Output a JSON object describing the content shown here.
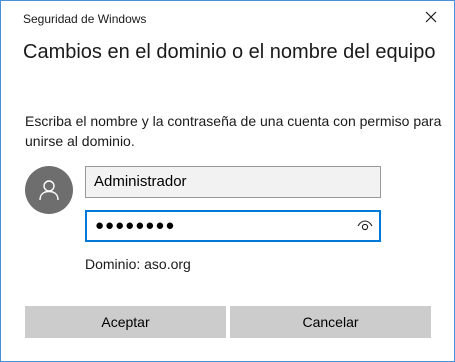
{
  "window": {
    "title": "Seguridad de Windows",
    "close_icon": "close-icon"
  },
  "heading": "Cambios en el dominio o el nombre del equipo",
  "description": "Escriba el nombre y la contraseña de una cuenta con permiso para unirse al dominio.",
  "avatar_icon": "user-avatar-icon",
  "username": {
    "value": "Administrador"
  },
  "password": {
    "masked_value": "●●●●●●●●",
    "reveal_icon": "eye-icon"
  },
  "domain_text": "Dominio: aso.org",
  "buttons": {
    "ok": "Aceptar",
    "cancel": "Cancelar"
  },
  "colors": {
    "accent": "#0078d7",
    "button_bg": "#cccccc",
    "avatar_bg": "#6e6e6e",
    "dialog_border": "#4a90d9"
  }
}
